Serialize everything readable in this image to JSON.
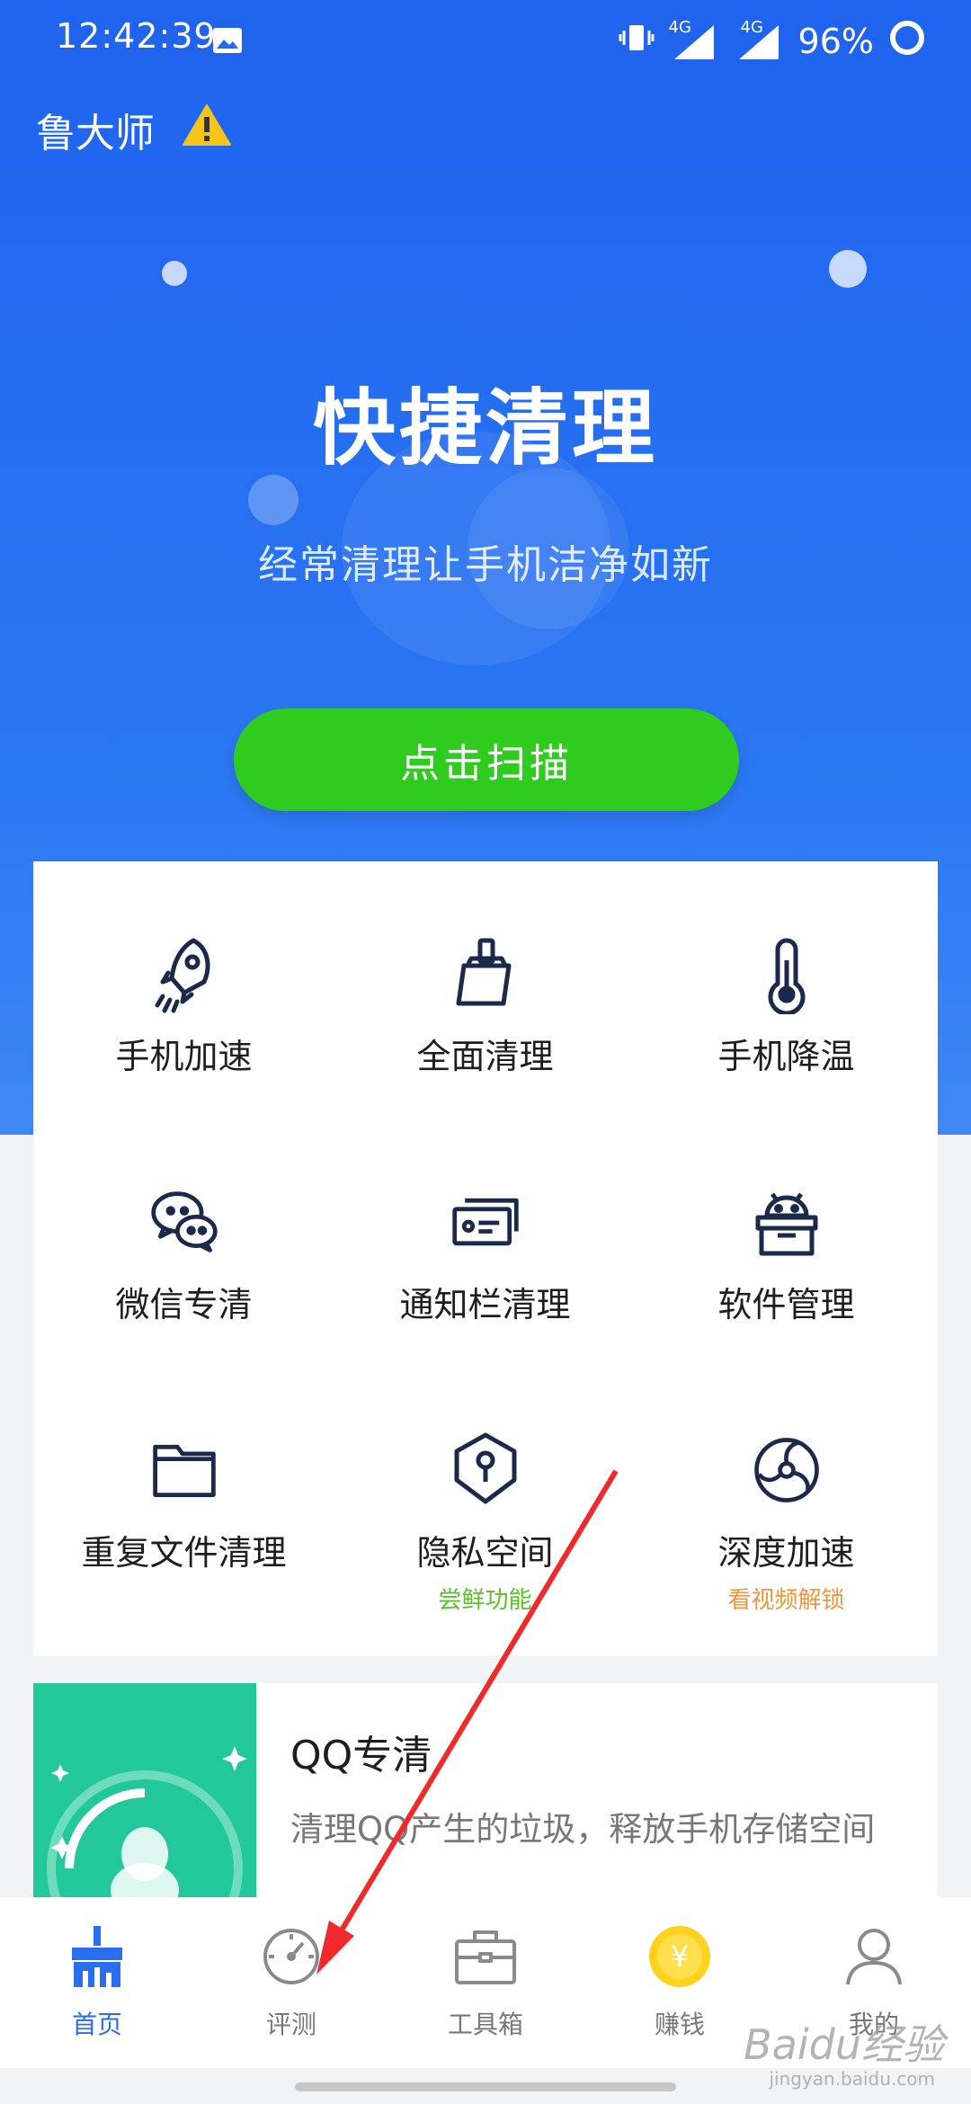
{
  "status_bar": {
    "time": "12:42:39",
    "network_1": "4G",
    "network_2": "4G",
    "battery": "96%"
  },
  "app": {
    "name": "鲁大师"
  },
  "hero": {
    "title": "快捷清理",
    "subtitle": "经常清理让手机洁净如新",
    "scan_button": "点击扫描"
  },
  "tools": [
    {
      "label": "手机加速",
      "icon": "rocket-icon"
    },
    {
      "label": "全面清理",
      "icon": "broom-icon"
    },
    {
      "label": "手机降温",
      "icon": "thermometer-icon"
    },
    {
      "label": "微信专清",
      "icon": "wechat-icon"
    },
    {
      "label": "通知栏清理",
      "icon": "notification-card-icon"
    },
    {
      "label": "软件管理",
      "icon": "android-box-icon"
    },
    {
      "label": "重复文件清理",
      "icon": "folder-icon"
    },
    {
      "label": "隐私空间",
      "icon": "shield-keyhole-icon",
      "sub": "尝鲜功能"
    },
    {
      "label": "深度加速",
      "icon": "fan-icon",
      "sub": "看视频解锁"
    }
  ],
  "promo": {
    "title": "QQ专清",
    "description": "清理QQ产生的垃圾，释放手机存储空间"
  },
  "tabs": [
    {
      "label": "首页",
      "icon": "broom-chart-icon",
      "active": true
    },
    {
      "label": "评测",
      "icon": "speedometer-icon"
    },
    {
      "label": "工具箱",
      "icon": "toolbox-icon"
    },
    {
      "label": "赚钱",
      "icon": "coin-icon"
    },
    {
      "label": "我的",
      "icon": "user-icon"
    }
  ],
  "watermark": {
    "brand": "Baidu经验",
    "url": "jingyan.baidu.com"
  },
  "colors": {
    "primary": "#2a6ef0",
    "scan_button": "#2fcb1f",
    "sub_green": "#5cbf2a",
    "sub_orange": "#f0953a",
    "icon_navy": "#1b2a4a"
  }
}
